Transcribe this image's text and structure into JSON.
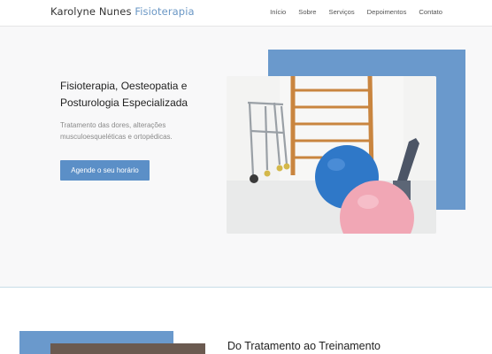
{
  "header": {
    "logo_name": "Karolyne Nunes",
    "logo_brand": "Fisioterapia",
    "nav": [
      "Início",
      "Sobre",
      "Serviços",
      "Depoimentos",
      "Contato"
    ]
  },
  "hero": {
    "title": "Fisioterapia, Oesteopatia e Posturologia Especializada",
    "subtitle": "Tratamento das dores, alterações musculoesqueléticas e ortopédicas.",
    "cta_label": "Agende o seu horário",
    "image": "physiotherapy-room-photo"
  },
  "section2": {
    "title": "Do Tratamento ao Treinamento",
    "image": "portrait-photo"
  },
  "colors": {
    "accent": "#5b8fc7",
    "block": "#6a99cc",
    "brand_text": "#6a97c5"
  }
}
